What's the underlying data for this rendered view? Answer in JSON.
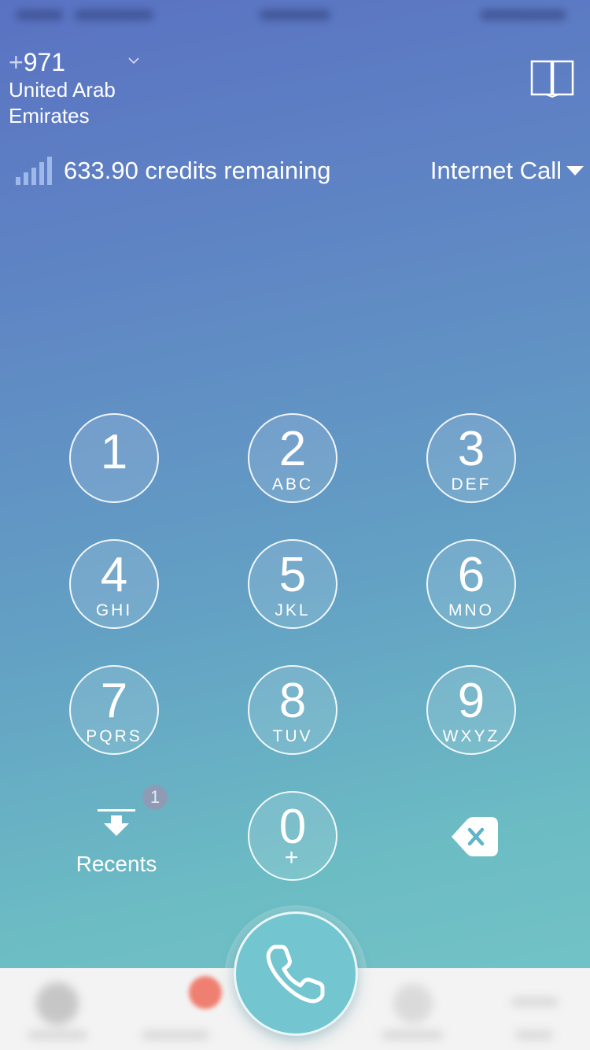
{
  "header": {
    "country_code": "971",
    "country_code_prefix": "+",
    "country_name": "United Arab Emirates"
  },
  "credits": {
    "text": "633.90 credits remaining"
  },
  "call_type": {
    "label": "Internet Call"
  },
  "keypad": {
    "keys": [
      {
        "digit": "1",
        "letters": ""
      },
      {
        "digit": "2",
        "letters": "ABC"
      },
      {
        "digit": "3",
        "letters": "DEF"
      },
      {
        "digit": "4",
        "letters": "GHI"
      },
      {
        "digit": "5",
        "letters": "JKL"
      },
      {
        "digit": "6",
        "letters": "MNO"
      },
      {
        "digit": "7",
        "letters": "PQRS"
      },
      {
        "digit": "8",
        "letters": "TUV"
      },
      {
        "digit": "9",
        "letters": "WXYZ"
      },
      {
        "digit": "0",
        "letters": "+"
      }
    ]
  },
  "recents": {
    "label": "Recents",
    "badge_count": "1"
  },
  "colors": {
    "background_top": "#5a72c2",
    "background_bottom": "#74c6c7",
    "call_button": "#73c5cf",
    "badge": "#8f9bb5",
    "notification_dot": "#ef6b5a"
  },
  "icons": {
    "contacts": "book-icon",
    "signal": "signal-bars-icon",
    "backspace": "backspace-icon",
    "recents": "recents-arrow-icon",
    "call": "phone-icon"
  }
}
